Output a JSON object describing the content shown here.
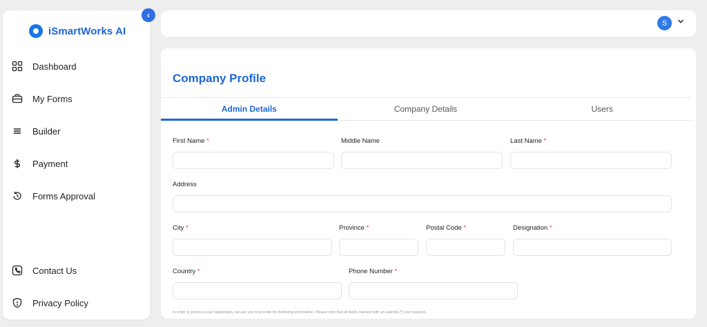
{
  "sidebar": {
    "brand": "iSmartWorks AI",
    "items": [
      {
        "label": "Dashboard",
        "icon": "grid-icon"
      },
      {
        "label": "My Forms",
        "icon": "briefcase-icon"
      },
      {
        "label": "Builder",
        "icon": "menu-lines-icon"
      },
      {
        "label": "Payment",
        "icon": "dollar-icon"
      },
      {
        "label": "Forms Approval",
        "icon": "history-icon"
      }
    ],
    "bottom_items": [
      {
        "label": "Contact Us",
        "icon": "phone-icon"
      },
      {
        "label": "Privacy Policy",
        "icon": "shield-icon"
      }
    ]
  },
  "header": {
    "avatar_initial": "S"
  },
  "page": {
    "title": "Company Profile",
    "tabs": [
      "Admin Details",
      "Company Details",
      "Users"
    ],
    "active_tab": "Admin Details"
  },
  "form": {
    "first_name": "First Name",
    "middle_name": "Middle Name",
    "last_name": "Last Name",
    "address": "Address",
    "city": "City",
    "province": "Province",
    "postal_code": "Postal Code",
    "designation": "Designation",
    "country": "Country",
    "phone_number": "Phone Number",
    "required_mark": "*",
    "note": "In order to process your registration, we ask you to provide the following information. Please note that all fields marked with an asterisk (*) are required."
  },
  "colors": {
    "accent": "#1b66d6",
    "required": "#e53935",
    "background": "#eeeeee"
  }
}
